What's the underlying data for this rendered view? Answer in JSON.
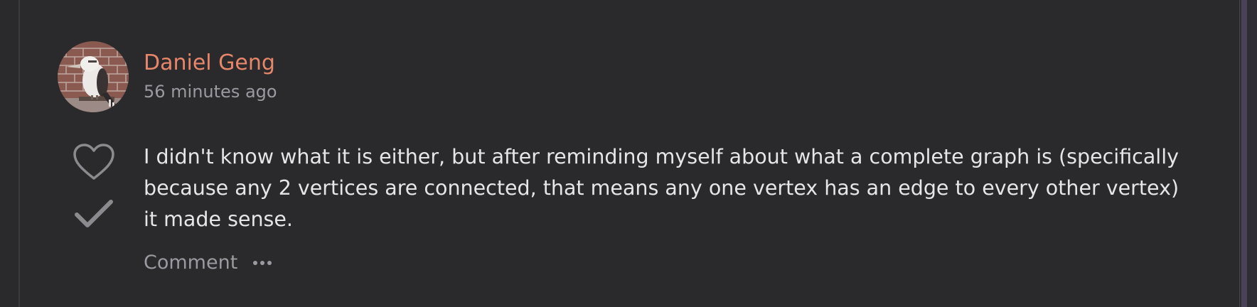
{
  "comment": {
    "author_name": "Daniel Geng",
    "timestamp": "56 minutes ago",
    "body": "I didn't know what it is either, but after reminding myself about what a complete graph is (specifically because any 2 vertices are connected, that means any one vertex has an edge to every other vertex) it made sense.",
    "actions": {
      "comment_label": "Comment"
    }
  },
  "colors": {
    "background": "#2a2a2d",
    "author_name": "#e8866a",
    "muted_text": "#9a9aa0",
    "body_text": "#e6e6e8",
    "icon": "#8a8a8f"
  },
  "icons": {
    "like": "heart-outline-icon",
    "accept": "checkmark-icon",
    "more": "ellipsis-icon"
  }
}
